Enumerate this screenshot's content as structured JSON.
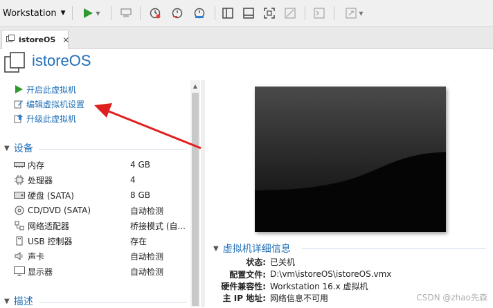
{
  "toolbar": {
    "workstation_label": "Workstation",
    "icons": [
      "play-icon",
      "send-keys-icon",
      "snapshot-icon",
      "revert-snapshot-icon",
      "snapshot-manager-icon",
      "library-view-icon",
      "console-view-icon",
      "full-screen-icon",
      "unity-icon",
      "terminal-icon",
      "stretch-icon"
    ]
  },
  "tab": {
    "label": "istoreOS",
    "close": "✕"
  },
  "vm": {
    "title": "istoreOS"
  },
  "actions": [
    {
      "label": "开启此虚拟机",
      "icon": "power-on-icon"
    },
    {
      "label": "编辑虚拟机设置",
      "icon": "edit-settings-icon"
    },
    {
      "label": "升级此虚拟机",
      "icon": "upgrade-icon"
    }
  ],
  "devices": {
    "title": "设备",
    "items": [
      {
        "name": "内存",
        "value": "4 GB",
        "icon": "memory-icon"
      },
      {
        "name": "处理器",
        "value": "4",
        "icon": "processor-icon"
      },
      {
        "name": "硬盘 (SATA)",
        "value": "8 GB",
        "icon": "hard-disk-icon"
      },
      {
        "name": "CD/DVD (SATA)",
        "value": "自动检测",
        "icon": "cd-dvd-icon"
      },
      {
        "name": "网络适配器",
        "value": "桥接模式 (自...",
        "icon": "network-adapter-icon"
      },
      {
        "name": "USB 控制器",
        "value": "存在",
        "icon": "usb-icon"
      },
      {
        "name": "声卡",
        "value": "自动检测",
        "icon": "sound-card-icon"
      },
      {
        "name": "显示器",
        "value": "自动检测",
        "icon": "display-icon"
      }
    ]
  },
  "description": {
    "title": "描述"
  },
  "details": {
    "title": "虚拟机详细信息",
    "rows": [
      {
        "label": "状态:",
        "value": "已关机"
      },
      {
        "label": "配置文件:",
        "value": "D:\\vm\\istoreOS\\istoreOS.vmx"
      },
      {
        "label": "硬件兼容性:",
        "value": "Workstation 16.x 虚拟机"
      },
      {
        "label": "主 IP 地址:",
        "value": "网络信息不可用"
      }
    ]
  },
  "watermark": "CSDN @zhao先森",
  "colors": {
    "accent": "#1f6fb8",
    "play_green": "#2e9a2e",
    "arrow_red": "#e02020"
  }
}
